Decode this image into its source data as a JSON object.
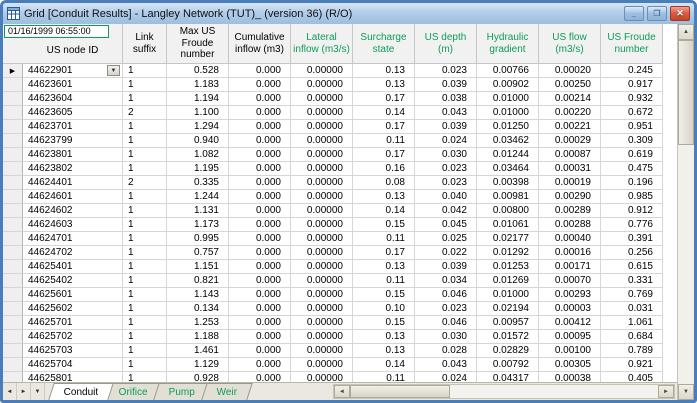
{
  "window": {
    "title": "Grid [Conduit Results] - Langley Network (TUT)_ (version 36) (R/O)"
  },
  "titlebar_buttons": {
    "minimize": "_",
    "maximize": "❐",
    "close": "✕"
  },
  "icons": {
    "row_marker": "▶",
    "dropdown": "▼"
  },
  "grid": {
    "green": "#0e9c57",
    "timestamp": "01/16/1999 06:55:00",
    "columns": [
      {
        "label": "US node ID",
        "green": false
      },
      {
        "label": "Link suffix",
        "green": false
      },
      {
        "label": "Max US Froude number",
        "green": false
      },
      {
        "label": "Cumulative inflow (m3)",
        "green": false
      },
      {
        "label": "Lateral inflow (m3/s)",
        "green": true
      },
      {
        "label": "Surcharge state",
        "green": true
      },
      {
        "label": "US depth (m)",
        "green": true
      },
      {
        "label": "Hydraulic gradient",
        "green": true
      },
      {
        "label": "US flow (m3/s)",
        "green": true
      },
      {
        "label": "US Froude number",
        "green": true
      }
    ],
    "rows": [
      [
        "44622901",
        "1",
        "0.528",
        "0.000",
        "0.00000",
        "0.13",
        "0.023",
        "0.00766",
        "0.00020",
        "0.245"
      ],
      [
        "44623601",
        "1",
        "1.183",
        "0.000",
        "0.00000",
        "0.13",
        "0.039",
        "0.00902",
        "0.00250",
        "0.917"
      ],
      [
        "44623604",
        "1",
        "1.194",
        "0.000",
        "0.00000",
        "0.17",
        "0.038",
        "0.01000",
        "0.00214",
        "0.932"
      ],
      [
        "44623605",
        "2",
        "1.100",
        "0.000",
        "0.00000",
        "0.14",
        "0.043",
        "0.01000",
        "0.00220",
        "0.672"
      ],
      [
        "44623701",
        "1",
        "1.294",
        "0.000",
        "0.00000",
        "0.17",
        "0.039",
        "0.01250",
        "0.00221",
        "0.951"
      ],
      [
        "44623799",
        "1",
        "0.940",
        "0.000",
        "0.00000",
        "0.11",
        "0.024",
        "0.03462",
        "0.00029",
        "0.309"
      ],
      [
        "44623801",
        "1",
        "1.082",
        "0.000",
        "0.00000",
        "0.17",
        "0.030",
        "0.01244",
        "0.00087",
        "0.619"
      ],
      [
        "44623802",
        "1",
        "1.195",
        "0.000",
        "0.00000",
        "0.16",
        "0.023",
        "0.03464",
        "0.00031",
        "0.475"
      ],
      [
        "44624401",
        "2",
        "0.335",
        "0.000",
        "0.00000",
        "0.08",
        "0.023",
        "0.00398",
        "0.00019",
        "0.196"
      ],
      [
        "44624601",
        "1",
        "1.244",
        "0.000",
        "0.00000",
        "0.13",
        "0.040",
        "0.00981",
        "0.00290",
        "0.985"
      ],
      [
        "44624602",
        "1",
        "1.131",
        "0.000",
        "0.00000",
        "0.14",
        "0.042",
        "0.00800",
        "0.00289",
        "0.912"
      ],
      [
        "44624603",
        "1",
        "1.173",
        "0.000",
        "0.00000",
        "0.15",
        "0.045",
        "0.01061",
        "0.00288",
        "0.776"
      ],
      [
        "44624701",
        "1",
        "0.995",
        "0.000",
        "0.00000",
        "0.11",
        "0.025",
        "0.02177",
        "0.00040",
        "0.391"
      ],
      [
        "44624702",
        "1",
        "0.757",
        "0.000",
        "0.00000",
        "0.17",
        "0.022",
        "0.01292",
        "0.00016",
        "0.256"
      ],
      [
        "44625401",
        "1",
        "1.151",
        "0.000",
        "0.00000",
        "0.13",
        "0.039",
        "0.01253",
        "0.00171",
        "0.615"
      ],
      [
        "44625402",
        "1",
        "0.821",
        "0.000",
        "0.00000",
        "0.11",
        "0.034",
        "0.01269",
        "0.00070",
        "0.331"
      ],
      [
        "44625601",
        "1",
        "1.143",
        "0.000",
        "0.00000",
        "0.15",
        "0.046",
        "0.01000",
        "0.00293",
        "0.769"
      ],
      [
        "44625602",
        "1",
        "0.134",
        "0.000",
        "0.00000",
        "0.10",
        "0.023",
        "0.02194",
        "0.00003",
        "0.031"
      ],
      [
        "44625701",
        "1",
        "1.253",
        "0.000",
        "0.00000",
        "0.15",
        "0.046",
        "0.00957",
        "0.00412",
        "1.061"
      ],
      [
        "44625702",
        "1",
        "1.188",
        "0.000",
        "0.00000",
        "0.13",
        "0.030",
        "0.01572",
        "0.00095",
        "0.684"
      ],
      [
        "44625703",
        "1",
        "1.461",
        "0.000",
        "0.00000",
        "0.13",
        "0.028",
        "0.02829",
        "0.00100",
        "0.789"
      ],
      [
        "44625704",
        "1",
        "1.129",
        "0.000",
        "0.00000",
        "0.14",
        "0.043",
        "0.00792",
        "0.00305",
        "0.921"
      ],
      [
        "44625801",
        "1",
        "0.928",
        "0.000",
        "0.00000",
        "0.11",
        "0.024",
        "0.04317",
        "0.00038",
        "0.405"
      ]
    ]
  },
  "tabs": {
    "nav": [
      "◄",
      "►",
      "▼"
    ],
    "items": [
      {
        "label": "Conduit",
        "active": true
      },
      {
        "label": "Orifice",
        "active": false
      },
      {
        "label": "Pump",
        "active": false
      },
      {
        "label": "Weir",
        "active": false
      }
    ]
  },
  "scrollbars": {
    "up": "▲",
    "down": "▼",
    "left": "◄",
    "right": "►"
  }
}
